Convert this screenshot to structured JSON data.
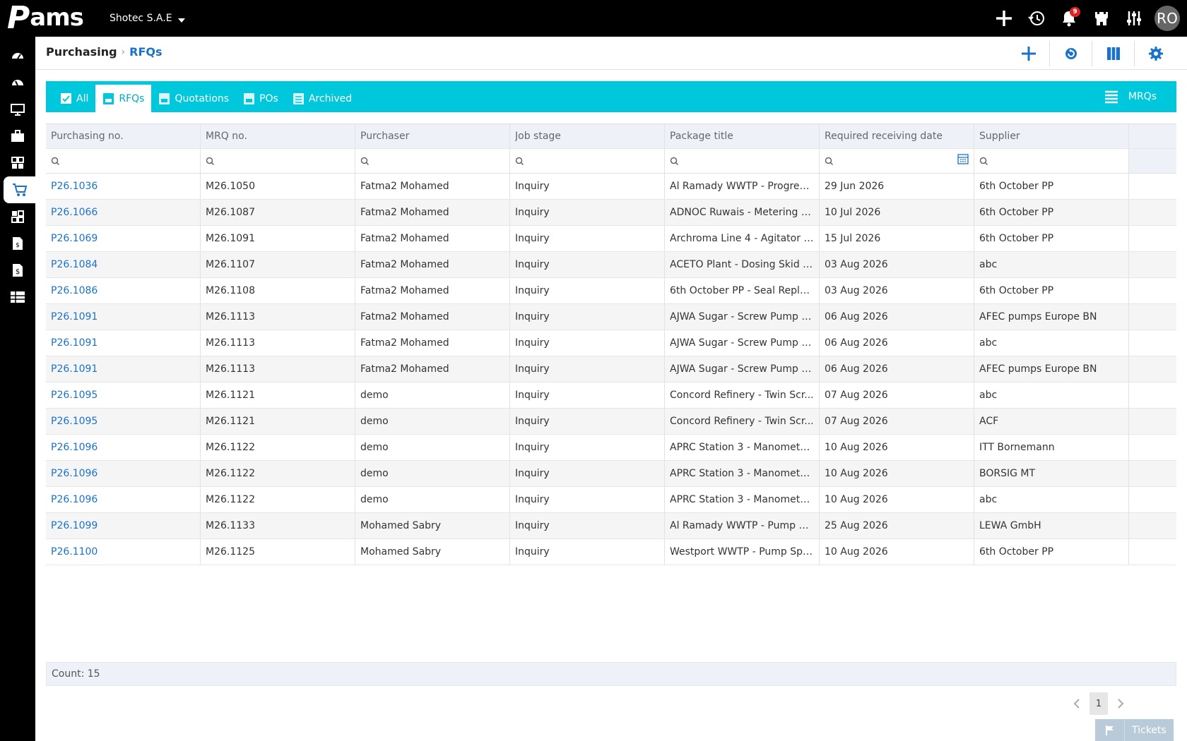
{
  "app": {
    "logo": "Pams",
    "company": "Shotec S.A.E",
    "notification_count": "9",
    "avatar_initials": "RO",
    "accent": "#00c8dc",
    "link_color": "#1a73c8"
  },
  "breadcrumb": {
    "section": "Purchasing",
    "page": "RFQs"
  },
  "tabs": [
    {
      "label": "All",
      "icon": "checkbox-icon"
    },
    {
      "label": "RFQs",
      "icon": "rfq-doc-icon",
      "active": true
    },
    {
      "label": "Quotations",
      "icon": "quotation-doc-icon"
    },
    {
      "label": "POs",
      "icon": "po-doc-icon"
    },
    {
      "label": "Archived",
      "icon": "archive-icon"
    }
  ],
  "mrqs_label": "MRQs",
  "table": {
    "columns": [
      "Purchasing no.",
      "MRQ no.",
      "Purchaser",
      "Job stage",
      "Package title",
      "Required receiving date",
      "Supplier"
    ],
    "rows": [
      [
        "P26.1036",
        "M26.1050",
        "Fatma2 Mohamed",
        "Inquiry",
        "Al Ramady WWTP - Progressi...",
        "29 Jun 2026",
        "6th October PP"
      ],
      [
        "P26.1066",
        "M26.1087",
        "Fatma2 Mohamed",
        "Inquiry",
        "ADNOC Ruwais - Metering P...",
        "10 Jul 2026",
        "6th October PP"
      ],
      [
        "P26.1069",
        "M26.1091",
        "Fatma2 Mohamed",
        "Inquiry",
        "Archroma Line 4 - Agitator G...",
        "15 Jul 2026",
        "6th October PP"
      ],
      [
        "P26.1084",
        "M26.1107",
        "Fatma2 Mohamed",
        "Inquiry",
        "ACETO Plant - Dosing Skid C...",
        "03 Aug 2026",
        "abc"
      ],
      [
        "P26.1086",
        "M26.1108",
        "Fatma2 Mohamed",
        "Inquiry",
        "6th October PP - Seal Replac...",
        "03 Aug 2026",
        "6th October PP"
      ],
      [
        "P26.1091",
        "M26.1113",
        "Fatma2 Mohamed",
        "Inquiry",
        "AJWA Sugar - Screw Pump R...",
        "06 Aug 2026",
        "AFEC pumps Europe BN"
      ],
      [
        "P26.1091",
        "M26.1113",
        "Fatma2 Mohamed",
        "Inquiry",
        "AJWA Sugar - Screw Pump R...",
        "06 Aug 2026",
        "abc"
      ],
      [
        "P26.1091",
        "M26.1113",
        "Fatma2 Mohamed",
        "Inquiry",
        "AJWA Sugar - Screw Pump R...",
        "06 Aug 2026",
        "AFEC pumps Europe BN"
      ],
      [
        "P26.1095",
        "M26.1121",
        "demo",
        "Inquiry",
        "Concord Refinery - Twin Scr...",
        "07 Aug 2026",
        "abc"
      ],
      [
        "P26.1095",
        "M26.1121",
        "demo",
        "Inquiry",
        "Concord Refinery - Twin Scr...",
        "07 Aug 2026",
        "ACF"
      ],
      [
        "P26.1096",
        "M26.1122",
        "demo",
        "Inquiry",
        "APRC Station 3 - Manometer...",
        "10 Aug 2026",
        "ITT Bornemann"
      ],
      [
        "P26.1096",
        "M26.1122",
        "demo",
        "Inquiry",
        "APRC Station 3 - Manometer...",
        "10 Aug 2026",
        "BORSIG MT"
      ],
      [
        "P26.1096",
        "M26.1122",
        "demo",
        "Inquiry",
        "APRC Station 3 - Manometer...",
        "10 Aug 2026",
        "abc"
      ],
      [
        "P26.1099",
        "M26.1133",
        "Mohamed Sabry",
        "Inquiry",
        "Al Ramady WWTP - Pump Sp...",
        "25 Aug 2026",
        "LEWA GmbH"
      ],
      [
        "P26.1100",
        "M26.1125",
        "Mohamed Sabry",
        "Inquiry",
        "Westport WWTP - Pump Spa...",
        "10 Aug 2026",
        "6th October PP"
      ]
    ]
  },
  "count_label": "Count: 15",
  "pager": {
    "current_page": "1"
  },
  "tickets_label": "Tickets"
}
